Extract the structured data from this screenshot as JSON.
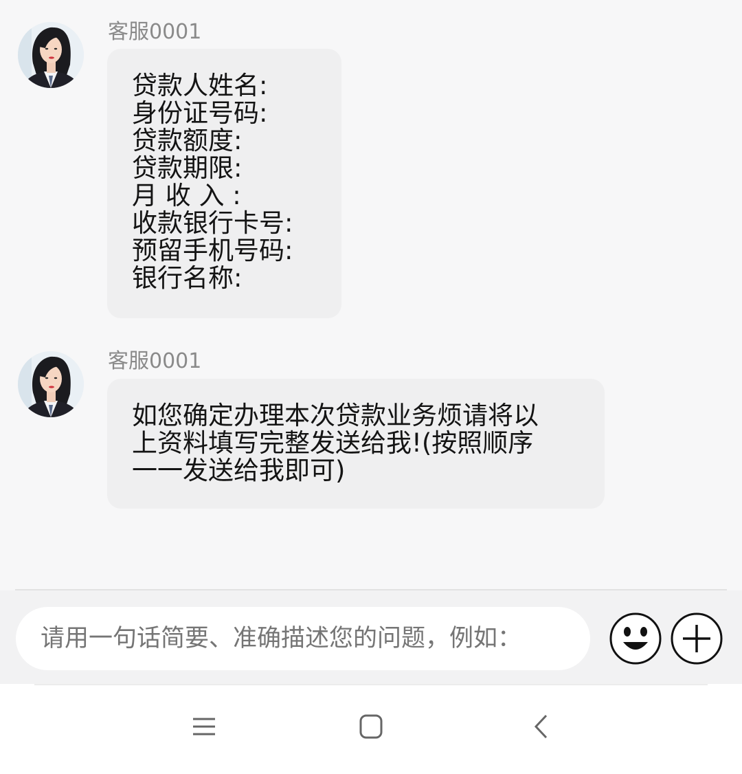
{
  "messages": [
    {
      "sender": "客服0001",
      "lines": [
        "贷款人姓名:",
        "身份证号码:",
        "贷款额度:",
        "贷款期限:",
        "月 收 入 :",
        "收款银行卡号:",
        "预留手机号码:",
        "银行名称:"
      ]
    },
    {
      "sender": "客服0001",
      "lines": [
        "如您确定办理本次贷款业务烦请将以",
        "上资料填写完整发送给我!(按照顺序",
        "一一发送给我即可)"
      ]
    }
  ],
  "input": {
    "placeholder": "请用一句话简要、准确描述您的问题，例如："
  },
  "icons": {
    "emoji": "smiley-face-icon",
    "add": "plus-circle-icon",
    "nav_menu": "menu-lines-icon",
    "nav_home": "rounded-square-icon",
    "nav_back": "chevron-left-icon"
  },
  "colors": {
    "bubble": "#efeff0",
    "background": "#f7f7f8",
    "sender_text": "#8a8a8a"
  }
}
